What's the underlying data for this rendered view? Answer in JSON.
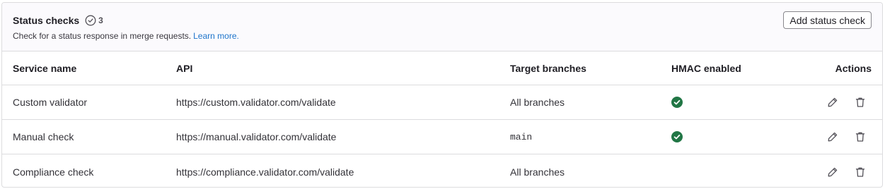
{
  "header": {
    "title": "Status checks",
    "count": "3",
    "description": "Check for a status response in merge requests.",
    "learn_more": "Learn more.",
    "add_button": "Add status check"
  },
  "table": {
    "columns": [
      "Service name",
      "API",
      "Target branches",
      "HMAC enabled",
      "Actions"
    ],
    "rows": [
      {
        "name": "Custom validator",
        "api": "https://custom.validator.com/validate",
        "target": "All branches",
        "hmac": true
      },
      {
        "name": "Manual check",
        "api": "https://manual.validator.com/validate",
        "target": "main",
        "hmac": true
      },
      {
        "name": "Compliance check",
        "api": "https://compliance.validator.com/validate",
        "target": "All branches",
        "hmac": false
      }
    ]
  },
  "colors": {
    "success": "#217645",
    "link": "#1f75cb",
    "border": "#dcdcde"
  }
}
